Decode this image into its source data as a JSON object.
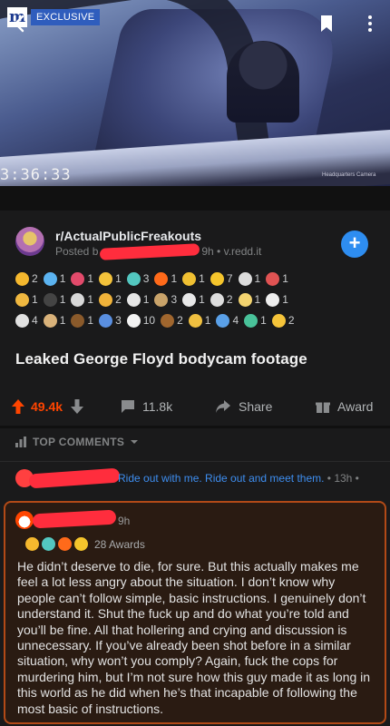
{
  "video": {
    "timestamp": "3:36:33",
    "watermark": "Headquarters Camera",
    "badge": "EXCLUSIVE",
    "logo_letter": "m"
  },
  "post": {
    "subreddit": "r/ActualPublicFreakouts",
    "posted_by_prefix": "Posted b",
    "posted_meta": "9h • v.redd.it",
    "title": "Leaked George Floyd bodycam footage"
  },
  "awards": {
    "rows": [
      [
        {
          "icon": "helmet-award-icon",
          "color": "#f5b82e",
          "count": "2"
        },
        {
          "icon": "ticket-award-icon",
          "color": "#5bb3f0",
          "count": "1"
        },
        {
          "icon": "broken-heart-award-icon",
          "color": "#e24a6b",
          "count": "1"
        },
        {
          "icon": "star-struck-award-icon",
          "color": "#f3c23b",
          "count": "1"
        },
        {
          "icon": "wholesome-award-icon",
          "color": "#53c7c0",
          "count": "3"
        },
        {
          "icon": "fire-award-icon",
          "color": "#ff6a1a",
          "count": "1"
        },
        {
          "icon": "hands-award-icon",
          "color": "#f0c032",
          "count": "1"
        },
        {
          "icon": "gold-award-icon",
          "color": "#f5c52c",
          "count": "7"
        },
        {
          "icon": "ribbon-award-icon",
          "color": "#dcdcdc",
          "count": "1"
        },
        {
          "icon": "rocket-award-icon",
          "color": "#e05353",
          "count": "1"
        }
      ],
      [
        {
          "icon": "face-award-icon",
          "color": "#f0b840",
          "count": "1"
        },
        {
          "icon": "saxophone-award-icon",
          "color": "#444",
          "count": "1"
        },
        {
          "icon": "skull-award-icon",
          "color": "#d8d8d8",
          "count": "1"
        },
        {
          "icon": "lion-award-icon",
          "color": "#f1b33a",
          "count": "2"
        },
        {
          "icon": "f-award-icon",
          "color": "#e6e6e6",
          "count": "1"
        },
        {
          "icon": "facepalm-award-icon",
          "color": "#c9a36a",
          "count": "3"
        },
        {
          "icon": "bow-award-icon",
          "color": "#e8e8e8",
          "count": "1"
        },
        {
          "icon": "cloud-award-icon",
          "color": "#dddddd",
          "count": "2"
        },
        {
          "icon": "eyes-award-icon",
          "color": "#f3d470",
          "count": "1"
        },
        {
          "icon": "panda-award-icon",
          "color": "#eeeeee",
          "count": "1"
        }
      ],
      [
        {
          "icon": "coin-award-icon",
          "color": "#e1e1e1",
          "count": "4"
        },
        {
          "icon": "shrug-award-icon",
          "color": "#d9b27a",
          "count": "1"
        },
        {
          "icon": "poop-award-icon",
          "color": "#8a5a2b",
          "count": "1"
        },
        {
          "icon": "wave-award-icon",
          "color": "#5a8fe0",
          "count": "3"
        },
        {
          "icon": "cake-award-icon",
          "color": "#f3f3f3",
          "count": "10"
        },
        {
          "icon": "pile-award-icon",
          "color": "#a0662e",
          "count": "2"
        },
        {
          "icon": "heart-shield-award-icon",
          "color": "#f0c040",
          "count": "1"
        },
        {
          "icon": "pointing-award-icon",
          "color": "#5aa0e8",
          "count": "4"
        },
        {
          "icon": "dragon-award-icon",
          "color": "#49c29a",
          "count": "1"
        },
        {
          "icon": "sunglasses-award-icon",
          "color": "#f5c43a",
          "count": "2"
        }
      ]
    ]
  },
  "actions": {
    "upvotes": "49.4k",
    "comments": "11.8k",
    "share": "Share",
    "award": "Award"
  },
  "comments_header": "TOP COMMENTS",
  "collapsed_comment": {
    "text": "Ride out with me. Ride out and meet them.",
    "time": " • 13h •"
  },
  "comment": {
    "time": "9h",
    "awards_label": "28 Awards",
    "award_icons": [
      {
        "icon": "helmet-award-icon",
        "color": "#f5b82e"
      },
      {
        "icon": "wholesome-award-icon",
        "color": "#53c7c0"
      },
      {
        "icon": "fire-award-icon",
        "color": "#ff6a1a"
      },
      {
        "icon": "gold-award-icon",
        "color": "#f5c52c"
      }
    ],
    "body": "He didn’t deserve to die, for sure. But this actually makes me feel a lot less angry about the situation. I don’t know why people can’t follow simple, basic instructions. I genuinely don’t understand it. Shut the fuck up and do what you’re told and you’ll be fine. All that hollering and crying and discussion is unnecessary. If you’ve already been shot before in a similar situation, why won’t you comply? Again, fuck the cops for murdering him, but I’m not sure how this guy made it as long in this world as he did when he’s that incapable of following the most basic of instructions."
  },
  "colors": {
    "upvote": "#ff4500",
    "link": "#3e8ef0",
    "highlight_border": "#b24a17",
    "join": "#2e8df0"
  }
}
